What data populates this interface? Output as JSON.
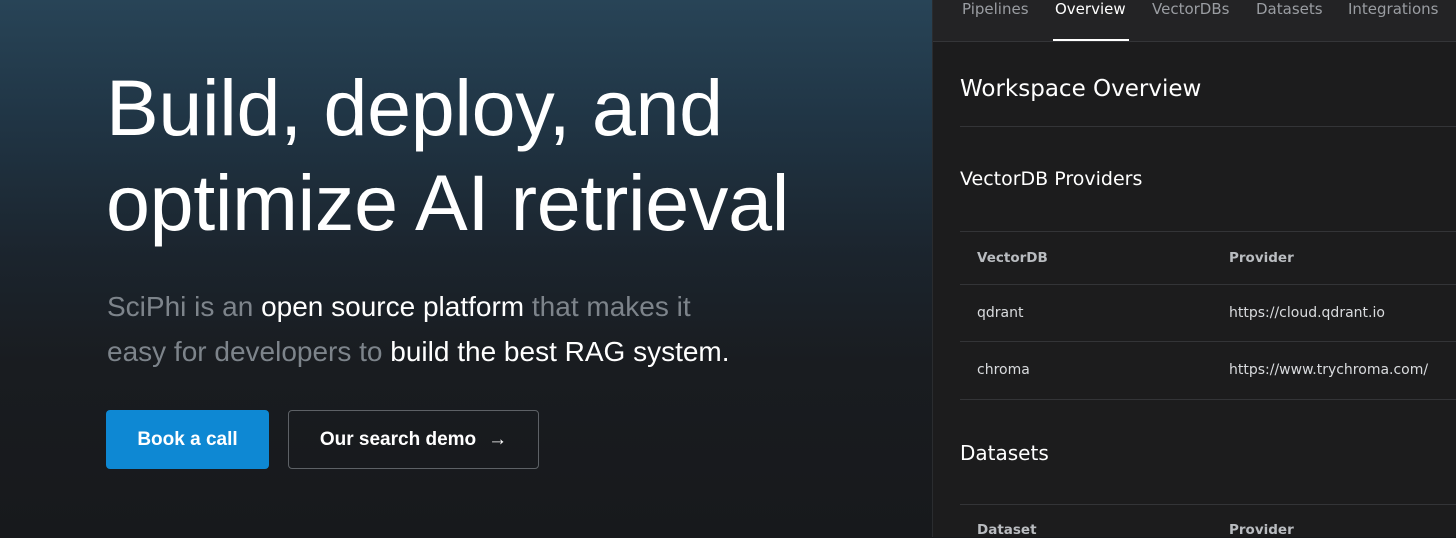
{
  "hero": {
    "headline_line1": "Build, deploy, and",
    "headline_line2": "optimize AI retrieval",
    "subtitle": {
      "p1": "SciPhi is an ",
      "p2": "open source platform",
      "p3": " that makes it",
      "p4": "easy for developers to ",
      "p5": "build the best RAG system."
    },
    "primary_button": "Book a call",
    "secondary_button": "Our search demo",
    "arrow_glyph": "→"
  },
  "dashboard": {
    "tabs": [
      {
        "label": "Pipelines",
        "active": false
      },
      {
        "label": "Overview",
        "active": true
      },
      {
        "label": "VectorDBs",
        "active": false
      },
      {
        "label": "Datasets",
        "active": false
      },
      {
        "label": "Integrations",
        "active": false
      }
    ],
    "title": "Workspace Overview",
    "vectordb_section": {
      "title": "VectorDB Providers",
      "columns": [
        "VectorDB",
        "Provider"
      ],
      "rows": [
        [
          "qdrant",
          "https://cloud.qdrant.io"
        ],
        [
          "chroma",
          "https://www.trychroma.com/"
        ]
      ]
    },
    "datasets_section": {
      "title": "Datasets",
      "columns": [
        "Dataset",
        "Provider"
      ]
    }
  },
  "colors": {
    "primary_button": "#0e88d3",
    "hero_gradient_top": "#284457",
    "background": "#17191c",
    "panel": "#1c1c1d",
    "muted_text": "#7d848b"
  }
}
